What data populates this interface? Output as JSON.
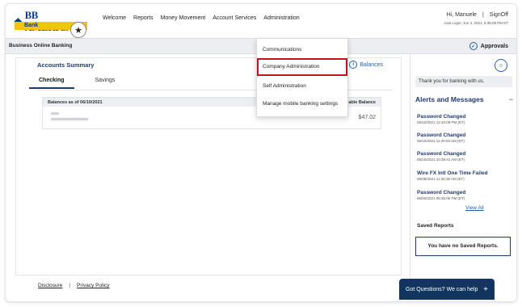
{
  "logo": {
    "name": "BB AMERICAS",
    "sub": "Bank"
  },
  "nav": [
    "Welcome",
    "Reports",
    "Money Movement",
    "Account Services",
    "Administration"
  ],
  "user": {
    "greeting": "Hi, Manuele",
    "signoff": "SignOff",
    "last_login": "Last Login: Jun 3, 2021, 5:35:08 PM ET"
  },
  "subbar": {
    "title": "Business Online Banking",
    "approvals": "Approvals"
  },
  "dropdown": [
    "Communications",
    "Company Administration",
    "Self Administration",
    "Manage mobile banking settings"
  ],
  "accounts": {
    "title": "Accounts Summary",
    "balances_link": "Balances",
    "tabs": [
      "Checking",
      "Savings"
    ],
    "table_header_left": "Balances as of 06/10/2021",
    "table_header_right": "...ilable Balance",
    "amount": "$47.02"
  },
  "sidebar": {
    "thanks": "Thank you for banking with us.",
    "alerts_title": "Alerts and Messages",
    "alerts": [
      {
        "title": "Password Changed",
        "date": "06/10/2021 12:40:09 PM (ET)"
      },
      {
        "title": "Password Changed",
        "date": "06/10/2021 11:20:03 AM (ET)"
      },
      {
        "title": "Password Changed",
        "date": "06/10/2021 10:39:41 AM (ET)"
      },
      {
        "title": "Wire FX Intl One Time Failed",
        "date": "06/08/2021 11:26:35 AM (ET)"
      },
      {
        "title": "Password Changed",
        "date": "06/03/2021 05:35:06 PM (ET)"
      }
    ],
    "view_all": "View All",
    "saved_title": "Saved Reports",
    "saved_empty": "You have no Saved Reports."
  },
  "footer": {
    "disclosure": "Disclosure",
    "privacy": "Privacy Policy"
  },
  "chat": {
    "label": "Got Questions? We can help"
  }
}
